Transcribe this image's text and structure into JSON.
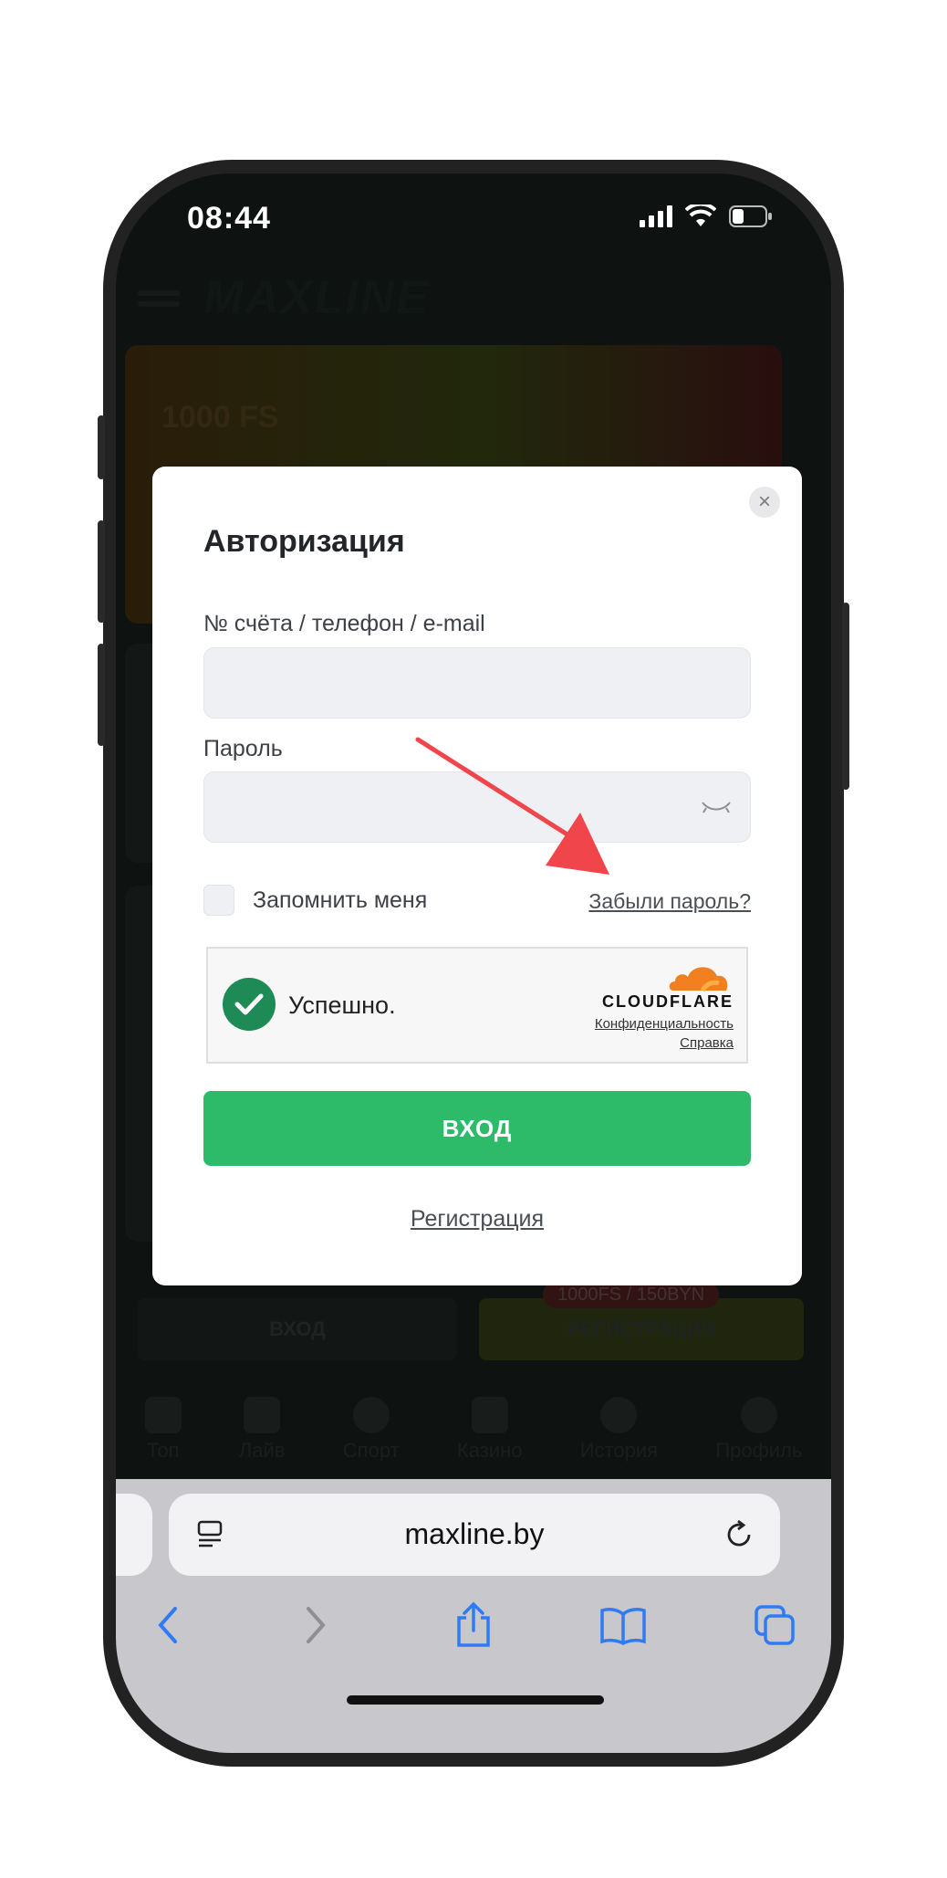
{
  "status_bar": {
    "time": "08:44"
  },
  "background_app": {
    "logo": "MAXLINE",
    "promo_text": "1000 FS",
    "login_label": "ВХОД",
    "register_label": "РЕГИСТРАЦИЯ",
    "badge": "1000FS / 150BYN",
    "tabs": [
      {
        "label": "Топ"
      },
      {
        "label": "Лайв"
      },
      {
        "label": "Спорт"
      },
      {
        "label": "Казино"
      },
      {
        "label": "История"
      },
      {
        "label": "Профиль"
      }
    ]
  },
  "modal": {
    "title": "Авторизация",
    "close_icon": "×",
    "account_label": "№ счёта / телефон / e-mail",
    "account_value": "",
    "password_label": "Пароль",
    "password_value": "",
    "remember_label": "Запомнить меня",
    "forgot_label": "Забыли пароль?",
    "captcha": {
      "status": "Успешно.",
      "brand": "CLOUDFLARE",
      "privacy_link": "Конфиденциальность",
      "help_link": "Справка"
    },
    "submit_label": "ВХОД",
    "register_link": "Регистрация"
  },
  "browser": {
    "url": "maxline.by",
    "icons": [
      "back-icon",
      "forward-icon",
      "share-icon",
      "bookmarks-icon",
      "tabs-icon",
      "reader-icon",
      "reload-icon"
    ]
  },
  "colors": {
    "accent_green": "#2dbb6a",
    "arrow_red": "#f0454a",
    "cloudflare_orange": "#f38020"
  }
}
